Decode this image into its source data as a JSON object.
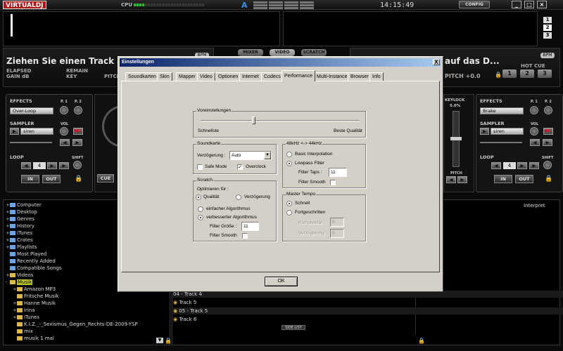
{
  "app": {
    "logo": "VIRTUALDJ",
    "cpu_label": "CPU",
    "auto_label": "A",
    "clock": "14:15:49",
    "config_label": "CONFIG",
    "deck_buttons": [
      "1",
      "2",
      "3"
    ]
  },
  "deck_left": {
    "drag_text": "Ziehen Sie einen Track auf d",
    "bpm_badge": "BPM",
    "elapsed": "ELAPSED",
    "remain": "REMAIN",
    "gain": "GAIN dB",
    "key": "KEY",
    "pitch": "PITCH"
  },
  "deck_right": {
    "drag_text": "auf das D...",
    "bpm_badge": "BPM",
    "pitch": "PITCH +0.0",
    "hot_cue": "HOT CUE",
    "cues": [
      "1",
      "2",
      "3"
    ],
    "keylock": "KEYLOCK",
    "keylock_pct": "5.0%",
    "pitch_label": "PITCH"
  },
  "center_tabs": [
    "MIXER",
    "VIDEO",
    "SCRATCH"
  ],
  "left_panel": {
    "effects": "EFFECTS",
    "p1": "P. 1",
    "p2": "P. 2",
    "effect_value": "Over-Loop",
    "sampler": "SAMPLER",
    "vol": "VOL",
    "sampler_value": "siren",
    "rec": "REC",
    "loop": "LOOP",
    "shift": "SHIFT",
    "loop_value": "4",
    "in": "IN",
    "out": "OUT",
    "cue": "CUE"
  },
  "right_panel": {
    "effects": "EFFECTS",
    "p1": "P. 1",
    "p2": "P. 2",
    "effect_value": "Brake",
    "sampler": "SAMPLER",
    "vol": "VOL",
    "sampler_value": "siren",
    "rec": "REC",
    "loop": "LOOP",
    "shift": "SHIFT",
    "loop_value": "4",
    "in": "IN",
    "out": "OUT"
  },
  "browser": {
    "tree": [
      {
        "label": "Computer",
        "exp": "+",
        "icon": "computer-icon",
        "indent": 0
      },
      {
        "label": "Desktop",
        "exp": "+",
        "icon": "desktop-icon",
        "indent": 0
      },
      {
        "label": "Genres",
        "exp": "+",
        "icon": "genres-icon",
        "indent": 0
      },
      {
        "label": "History",
        "exp": "+",
        "icon": "history-icon",
        "indent": 0
      },
      {
        "label": "iTunes",
        "exp": "+",
        "icon": "itunes-icon",
        "indent": 0
      },
      {
        "label": "Crates",
        "exp": "+",
        "icon": "crates-icon",
        "indent": 0
      },
      {
        "label": "Playlists",
        "exp": "+",
        "icon": "playlists-icon",
        "indent": 0
      },
      {
        "label": "Most Played",
        "exp": "",
        "icon": "filter-icon",
        "indent": 0
      },
      {
        "label": "Recently Added",
        "exp": "",
        "icon": "filter-icon",
        "indent": 0
      },
      {
        "label": "Compatible Songs",
        "exp": "",
        "icon": "filter-icon",
        "indent": 0
      },
      {
        "label": "Videos",
        "exp": "+",
        "icon": "folder-icon",
        "indent": 0
      },
      {
        "label": "Musik",
        "exp": "-",
        "icon": "folder-icon",
        "indent": 0,
        "selected": true
      },
      {
        "label": "Amazon MP3",
        "exp": "+",
        "icon": "folder-icon",
        "indent": 1
      },
      {
        "label": "Fritsche Musik",
        "exp": "",
        "icon": "folder-icon",
        "indent": 1
      },
      {
        "label": "Hanne Musik",
        "exp": "+",
        "icon": "folder-icon",
        "indent": 1
      },
      {
        "label": "irina",
        "exp": "+",
        "icon": "folder-icon",
        "indent": 1
      },
      {
        "label": "iTunes",
        "exp": "+",
        "icon": "folder-icon",
        "indent": 1
      },
      {
        "label": "K.I.Z._-_Sexismus_Gegen_Rechts-DE-2009-YSP",
        "exp": "",
        "icon": "folder-icon",
        "indent": 1
      },
      {
        "label": "mix",
        "exp": "",
        "icon": "folder-icon",
        "indent": 1
      },
      {
        "label": "musik 1 mal",
        "exp": "",
        "icon": "folder-icon",
        "indent": 1
      }
    ],
    "interpret_header": "Interpret",
    "tracks": [
      "04 - Track  4",
      "Track  5",
      "05 - Track  5",
      "Track  6"
    ],
    "side_list": "SIDE LIST"
  },
  "dialog": {
    "title": "Einstellungen",
    "close": "X",
    "tabs": [
      "Soundkarten",
      "Skin",
      "Mapper",
      "Video",
      "Optionen",
      "Internet",
      "Codecs",
      "Performance",
      "Multi-Instance",
      "Browser",
      "Info"
    ],
    "active_tab": "Performance",
    "presets": {
      "label": "Voreinstellungen",
      "left": "Schnellste",
      "right": "Beste Qualität"
    },
    "soundkarte": {
      "label": "Soundkarte",
      "delay_label": "Verzögerung :",
      "delay_value": "Auto",
      "safe_mode": "Safe Mode",
      "safe_mode_checked": false,
      "overclock": "Overclock",
      "overclock_checked": true
    },
    "scratch": {
      "label": "Scratch",
      "optimize_label": "Optimieren für :",
      "opt_quality": "Qualität",
      "opt_delay": "Verzögerung",
      "opt_selected": "Qualität",
      "algo_simple": "einfacher Algorithmus",
      "algo_improved": "verbesserter Algorithmus",
      "algo_selected": "verbesserter Algorithmus",
      "filter_size_label": "Filter Größe :",
      "filter_size_value": "11",
      "filter_smooth": "Filter Smooth",
      "filter_smooth_checked": false
    },
    "resample": {
      "label": "48kHz <-> 44kHz",
      "basic": "Basic Interpolation",
      "lowpass": "Lowpass Filter",
      "selected": "Lowpass Filter",
      "taps_label": "Filter Taps :",
      "taps_value": "11",
      "filter_smooth": "Filter Smooth",
      "filter_smooth_checked": false
    },
    "master_tempo": {
      "label": "Master Tempo",
      "fast": "Schnell",
      "advanced": "Fortgeschritten",
      "selected": "Schnell",
      "complexity_label": "Komplexität :",
      "complexity_value": "0",
      "delay_label": "Verzögerung :",
      "delay_value": "0"
    },
    "ok": "OK"
  }
}
